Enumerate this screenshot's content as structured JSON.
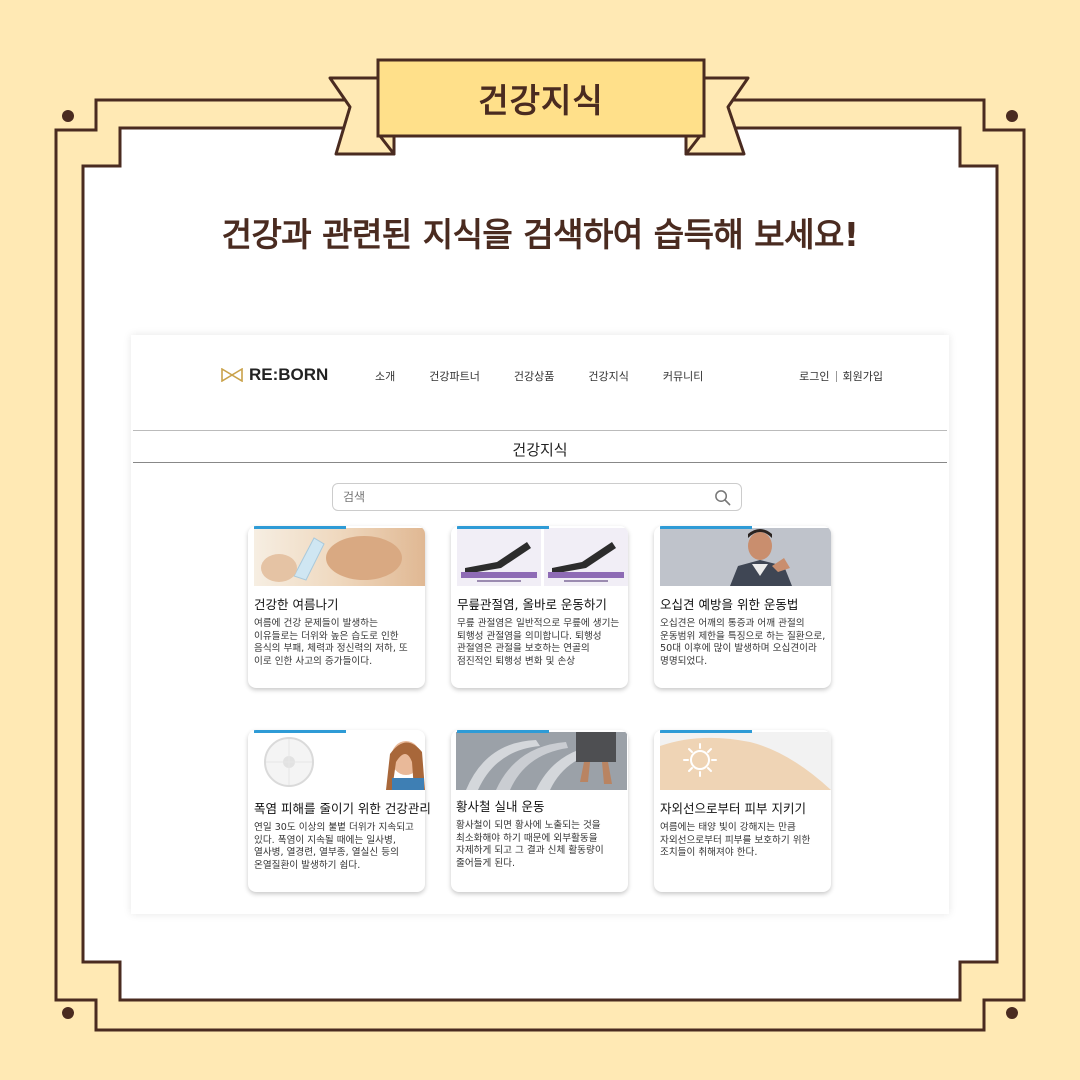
{
  "ribbon": {
    "title": "건강지식"
  },
  "headline": "건강과 관련된 지식을 검색하여 습득해 보세요!",
  "site": {
    "logo_text": "RE:BORN",
    "nav": [
      "소개",
      "건강파트너",
      "건강상품",
      "건강지식",
      "커뮤니티"
    ],
    "auth": {
      "login": "로그인",
      "signup": "회원가입"
    },
    "section_title": "건강지식",
    "search": {
      "placeholder": "검색",
      "value": ""
    },
    "cards": [
      {
        "title": "건강한 여름나기",
        "body": "여름에 건강 문제들이 발생하는 이유들로는 더위와 높은 습도로 인한 음식의 부패, 체력과 정신력의 저하, 또 이로 인한 사고의 증가들이다.",
        "image": "woman-drinking-water"
      },
      {
        "title": "무릎관절염, 올바로 운동하기",
        "body": "무릎 관절염은 일반적으로 무릎에 생기는 퇴행성 관절염을 의미합니다. 퇴행성 관절염은 관절을 보호하는 연골의 점진적인 퇴행성 변화 및 손상",
        "image": "knee-exercise"
      },
      {
        "title": "오십견 예방을 위한 운동법",
        "body": "오십견은 어깨의 통증과 어깨 관절의 운동범위 제한을 특징으로 하는 질환으로, 50대 이후에 많이 발생하며 오십견이라 명명되었다.",
        "image": "man-shoulder-pain"
      },
      {
        "title": "폭염 피해를 줄이기 위한 건강관리",
        "body": "연일 30도 이상의 불볕 더위가 지속되고 있다. 폭염이 지속될 때에는 일사병, 열사병, 열경련, 열부종, 열실신 등의 온열질환이 발생하기 쉽다.",
        "image": "fan-and-girl"
      },
      {
        "title": "황사철 실내 운동",
        "body": "황사철이 되면 황사에 노출되는 것을 최소화해야 하기 때문에 외부활동을 자제하게 되고 그 결과 신체 활동량이 줄어들게 된다.",
        "image": "treadmill-runners"
      },
      {
        "title": "자외선으로부터 피부 지키기",
        "body": "여름에는 태양 빛이 강해지는 만큼 자외선으로부터 피부를 보호하기 위한 조치들이 취해져야 한다.",
        "image": "sun-on-shoulder"
      }
    ]
  },
  "colors": {
    "background": "#FFE9B4",
    "frame": "#4A2B20",
    "ribbon": "#FFE08A",
    "accent": "#2E9BD6"
  }
}
